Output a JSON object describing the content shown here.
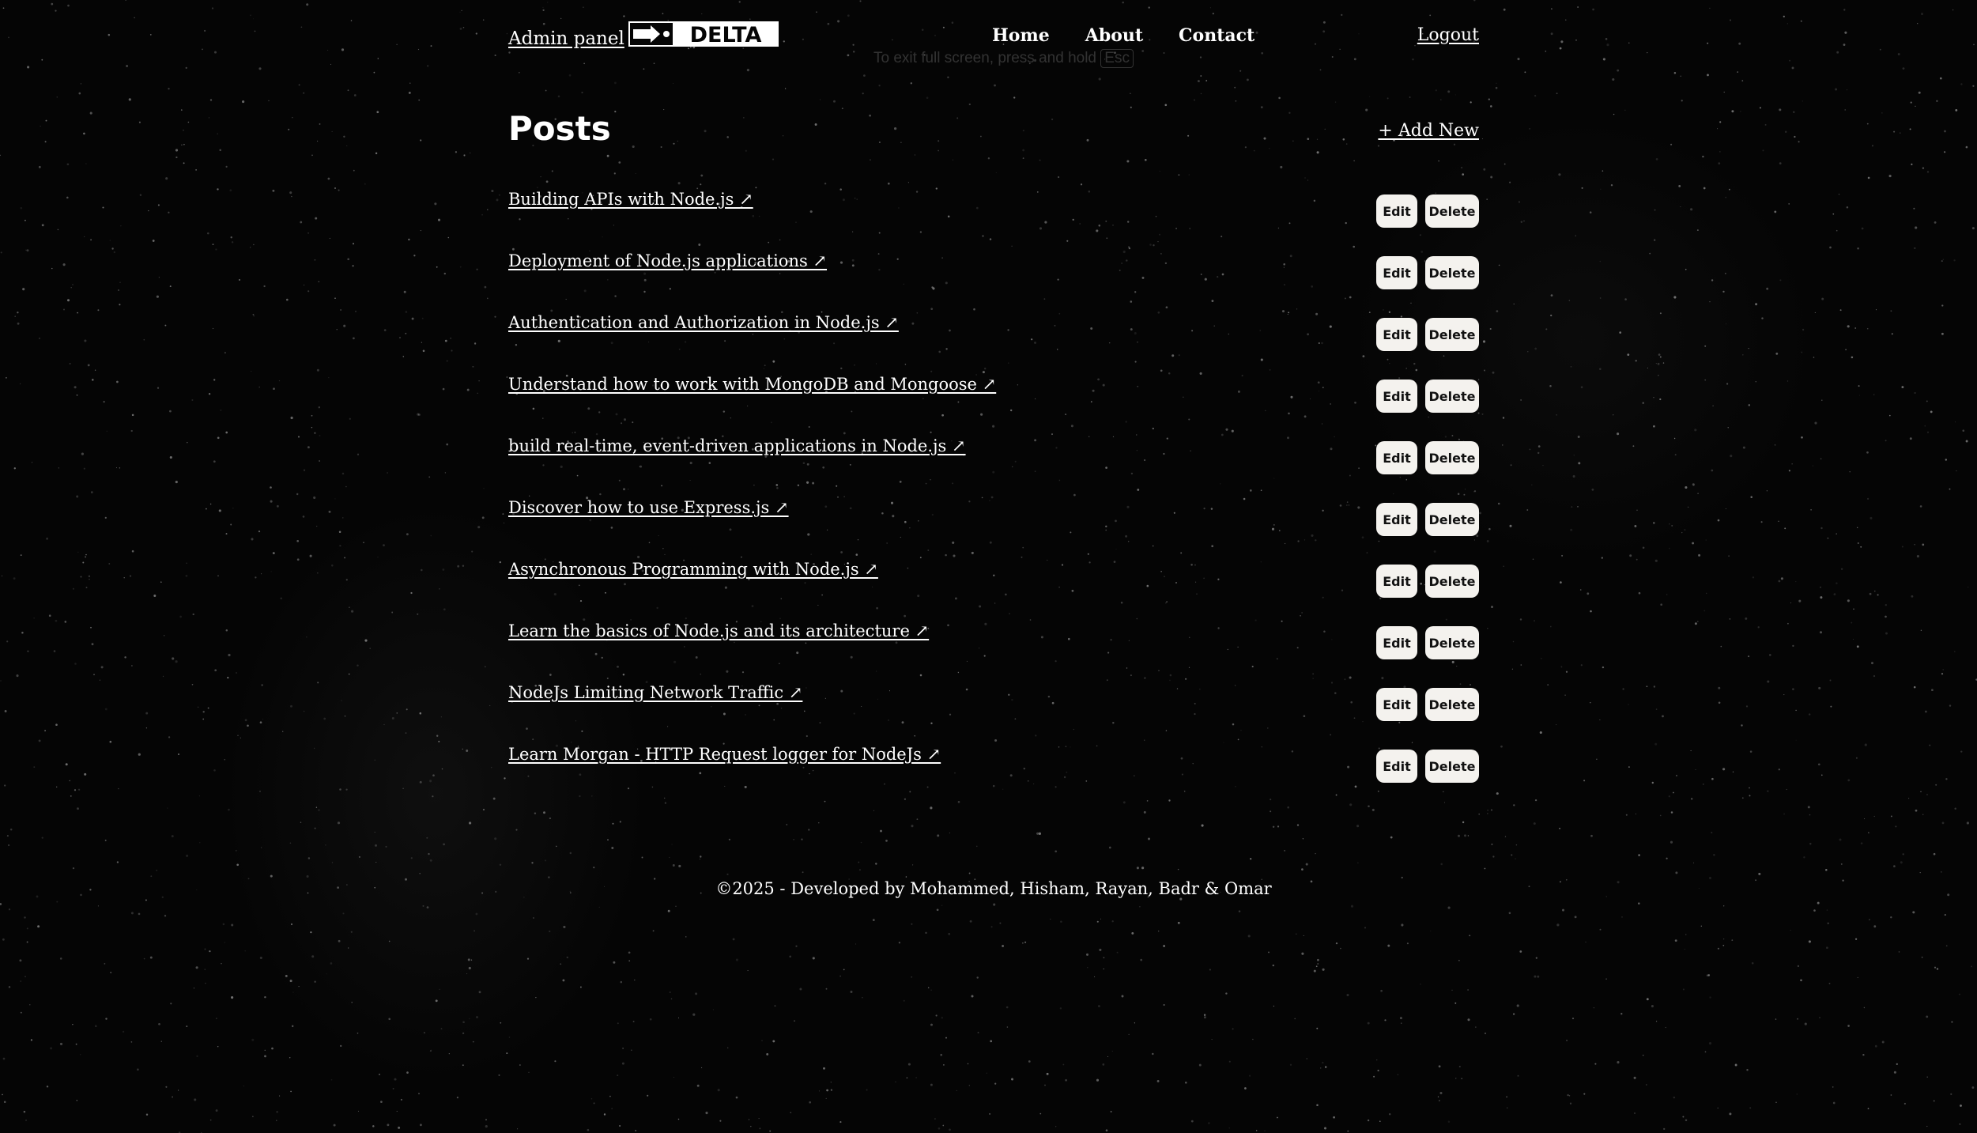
{
  "header": {
    "admin_label": "Admin panel",
    "logo_text": "DELTA",
    "nav": [
      {
        "label": "Home"
      },
      {
        "label": "About"
      },
      {
        "label": "Contact"
      }
    ],
    "fullscreen_hint_prefix": "To exit full screen, press and hold",
    "fullscreen_hint_key": "Esc",
    "logout_label": "Logout"
  },
  "main": {
    "title": "Posts",
    "add_new_label": "+ Add New",
    "edit_label": "Edit",
    "delete_label": "Delete",
    "posts": [
      {
        "title": "Building APIs with Node.js ↗"
      },
      {
        "title": "Deployment of Node.js applications ↗"
      },
      {
        "title": "Authentication and Authorization in Node.js ↗"
      },
      {
        "title": "Understand how to work with MongoDB and Mongoose ↗"
      },
      {
        "title": "build real-time, event-driven applications in Node.js ↗"
      },
      {
        "title": "Discover how to use Express.js ↗"
      },
      {
        "title": "Asynchronous Programming with Node.js ↗"
      },
      {
        "title": "Learn the basics of Node.js and its architecture ↗"
      },
      {
        "title": "NodeJs Limiting Network Traffic ↗"
      },
      {
        "title": "Learn Morgan - HTTP Request logger for NodeJs ↗"
      }
    ]
  },
  "footer": {
    "text": "©2025 - Developed by Mohammed, Hisham, Rayan, Badr & Omar"
  },
  "colors": {
    "background": "#050505",
    "text": "#ffffff",
    "button_bg": "#f4f2ee",
    "button_text": "#111111"
  }
}
